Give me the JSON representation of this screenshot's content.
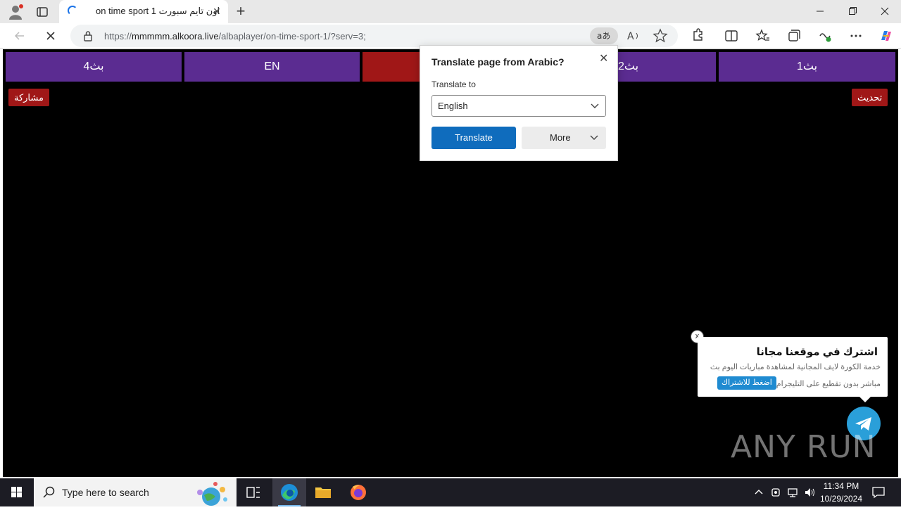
{
  "browser": {
    "tab_title": "on time sport 1 اون تايم سبورت",
    "tab_close": "✕",
    "new_tab": "+",
    "url_prefix": "https://",
    "url_domain": "mmmmm.alkoora.live",
    "url_path": "/albaplayer/on-time-sport-1/?serv=3;"
  },
  "page": {
    "servers": [
      {
        "label": "بث4",
        "active": false
      },
      {
        "label": "EN",
        "active": false
      },
      {
        "label": "",
        "active": true
      },
      {
        "label": "بث2",
        "active": false
      },
      {
        "label": "بث1",
        "active": false
      }
    ],
    "share_label": "مشاركة",
    "refresh_label": "تحديث"
  },
  "translate_popup": {
    "title": "Translate page from Arabic?",
    "label": "Translate to",
    "selected_language": "English",
    "translate_button": "Translate",
    "more_button": "More",
    "close": "✕"
  },
  "telegram_popup": {
    "title": "اشترك في موقعنا مجانا",
    "desc_line1": "خدمة الكورة لايف المجانية لمشاهدة مباريات اليوم بث",
    "desc_line2": "مباشر بدون تقطيع على التليجرام",
    "subscribe_button": "اضغط للاشتراك",
    "close": "x"
  },
  "watermark": "ANY RUN",
  "taskbar": {
    "search_placeholder": "Type here to search",
    "time": "11:34 PM",
    "date": "10/29/2024"
  },
  "colors": {
    "server_button": "#5b2c91",
    "active_red": "#a01717",
    "translate_blue": "#0f6cbd",
    "telegram_blue": "#2a9fd9"
  }
}
